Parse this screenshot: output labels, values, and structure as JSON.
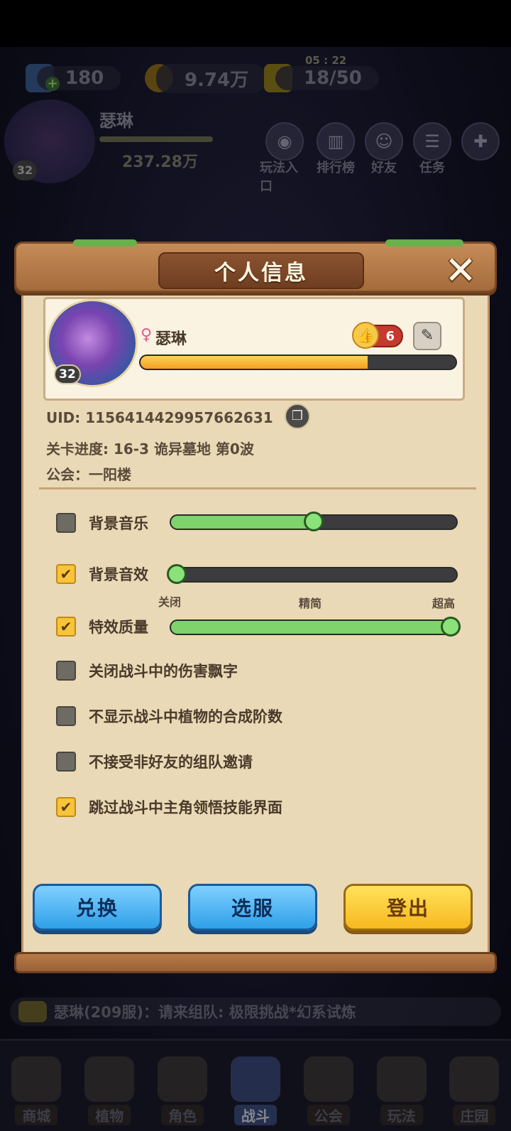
{
  "top_bar": {
    "gems": "180",
    "gold": "9.74万",
    "energy_timer": "05 : 22",
    "energy": "18/50"
  },
  "background_player": {
    "name": "瑟琳",
    "level": "32",
    "power": "237.28万"
  },
  "top_menu": [
    {
      "label": "玩法入口",
      "icon": "gamepad-icon"
    },
    {
      "label": "排行榜",
      "icon": "ranking-icon"
    },
    {
      "label": "好友",
      "icon": "friends-icon"
    },
    {
      "label": "任务",
      "icon": "task-icon"
    },
    {
      "label": "",
      "icon": "more-icon"
    }
  ],
  "dialog": {
    "title": "个人信息",
    "profile": {
      "name": "瑟琳",
      "level": "32",
      "likes": "6",
      "exp_progress": 0.72
    },
    "uid_line": "UID: 1156414429957662631",
    "stage_line": "关卡进度: 16-3  诡异墓地 第0波",
    "guild_line": "公会：一阳楼",
    "settings": [
      {
        "label": "背景音乐",
        "checked": false,
        "slider": 0.5
      },
      {
        "label": "背景音效",
        "checked": true,
        "slider": 0.0
      },
      {
        "label": "特效质量",
        "checked": true,
        "slider": 1.0
      },
      {
        "label": "关闭战斗中的伤害飘字",
        "checked": false
      },
      {
        "label": "不显示战斗中植物的合成阶数",
        "checked": false
      },
      {
        "label": "不接受非好友的组队邀请",
        "checked": false
      },
      {
        "label": "跳过战斗中主角领悟技能界面",
        "checked": true
      }
    ],
    "quality_ticks": [
      "关闭",
      "精简",
      "超高"
    ],
    "buttons": {
      "redeem": "兑换",
      "server": "选服",
      "logout": "登出"
    }
  },
  "chat": {
    "message": "瑟琳(209服)：请来组队: 极限挑战*幻系试炼"
  },
  "bottom_nav": [
    {
      "label": "商城"
    },
    {
      "label": "植物"
    },
    {
      "label": "角色"
    },
    {
      "label": "战斗"
    },
    {
      "label": "公会"
    },
    {
      "label": "玩法"
    },
    {
      "label": "庄园"
    }
  ],
  "colors": {
    "panel": "#ead9b6",
    "slider_fill": "#7ed36a",
    "exp_fill": "#f7b820",
    "button_blue": "#2fa0e8",
    "button_yellow": "#f7c43a"
  }
}
